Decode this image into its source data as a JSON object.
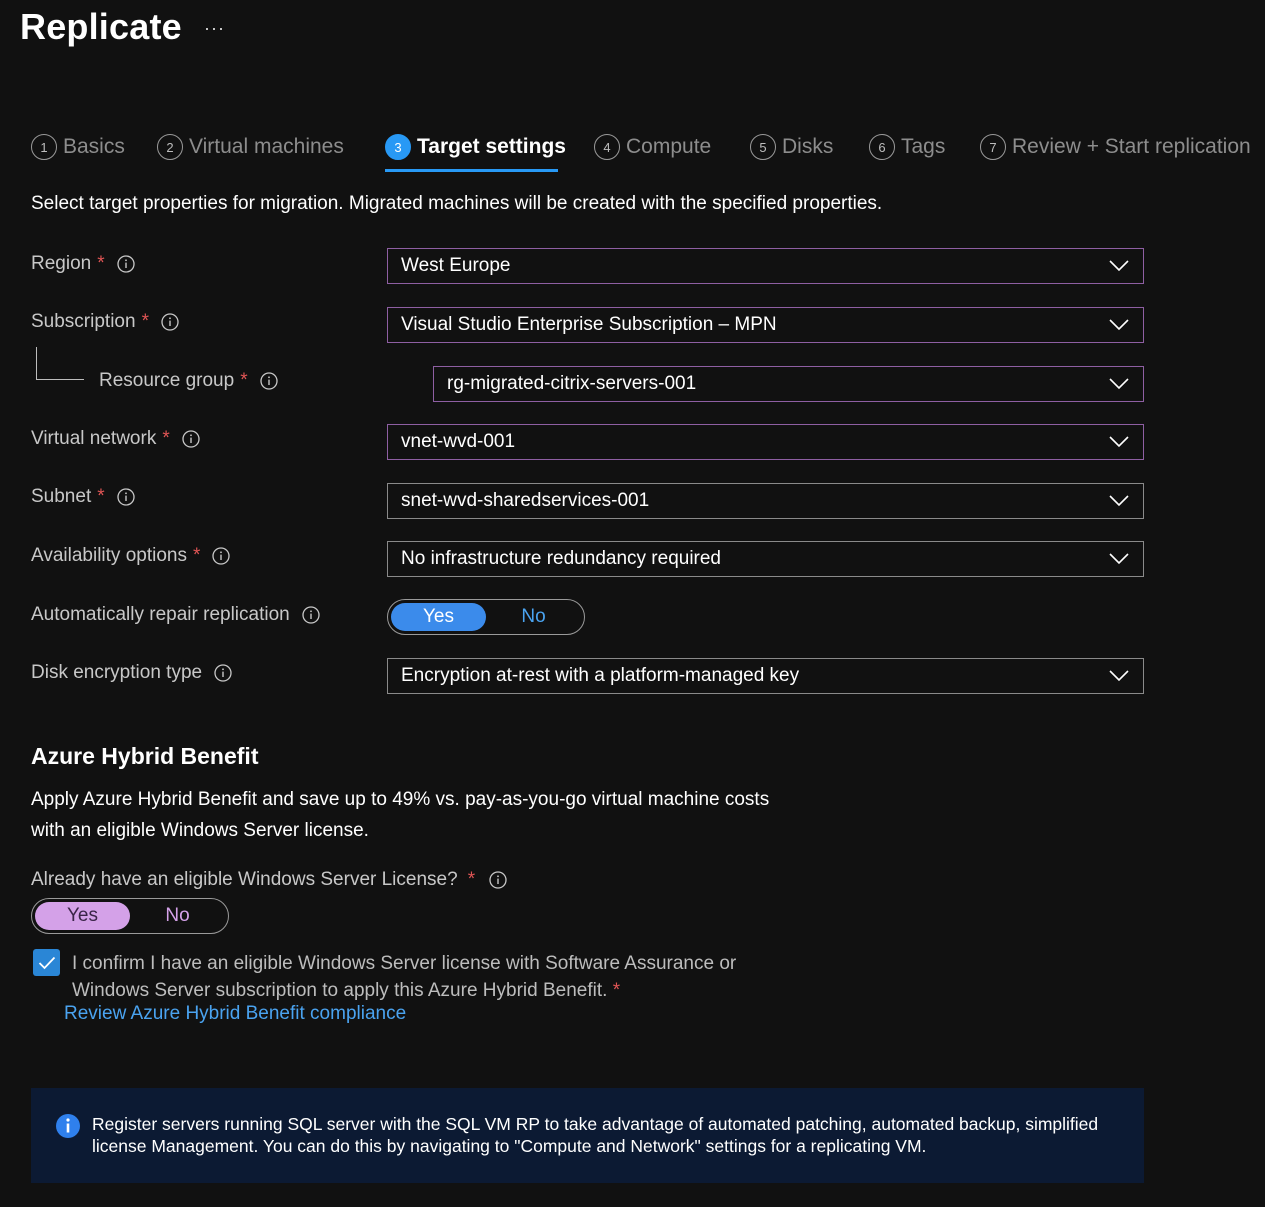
{
  "header": {
    "title": "Replicate",
    "more": "···"
  },
  "tabs": [
    {
      "num": "1",
      "label": "Basics"
    },
    {
      "num": "2",
      "label": "Virtual machines"
    },
    {
      "num": "3",
      "label": "Target settings"
    },
    {
      "num": "4",
      "label": "Compute"
    },
    {
      "num": "5",
      "label": "Disks"
    },
    {
      "num": "6",
      "label": "Tags"
    },
    {
      "num": "7",
      "label": "Review + Start replication"
    }
  ],
  "active_tab": "Target settings",
  "intro": "Select target properties for migration. Migrated machines will be created with the specified properties.",
  "form": {
    "required_mark": "*",
    "region": {
      "label": "Region",
      "value": "West Europe"
    },
    "subscription": {
      "label": "Subscription",
      "value": "Visual Studio Enterprise Subscription – MPN"
    },
    "resource_group": {
      "label": "Resource group",
      "value": "rg-migrated-citrix-servers-001"
    },
    "virtual_network": {
      "label": "Virtual network",
      "value": "vnet-wvd-001"
    },
    "subnet": {
      "label": "Subnet",
      "value": "snet-wvd-sharedservices-001"
    },
    "availability": {
      "label": "Availability options",
      "value": "No infrastructure redundancy required"
    },
    "auto_repair": {
      "label": "Automatically repair replication",
      "yes": "Yes",
      "no": "No",
      "selected": "Yes"
    },
    "disk_encryption": {
      "label": "Disk encryption type",
      "value": "Encryption at-rest with a platform-managed key"
    }
  },
  "hybrid": {
    "heading": "Azure Hybrid Benefit",
    "description_line1": "Apply Azure Hybrid Benefit and save up to 49% vs. pay-as-you-go virtual machine costs",
    "description_line2": "with an eligible Windows Server license.",
    "license_question": "Already have an eligible Windows Server License?",
    "toggle": {
      "yes": "Yes",
      "no": "No",
      "selected": "Yes"
    },
    "confirm_line1": "I confirm I have an eligible Windows Server license with Software Assurance  or",
    "confirm_line2": "Windows Server subscription to apply this Azure Hybrid Benefit.",
    "confirm_checked": true,
    "compliance_link": "Review Azure Hybrid Benefit compliance"
  },
  "banner": {
    "line1": "Register servers running SQL server with the SQL VM RP to take advantage of automated patching, automated backup, simplified",
    "line2": "license Management. You can do this by navigating to \"Compute and Network\" settings for a replicating VM."
  },
  "colors": {
    "accent": "#2899f5",
    "toggle_on_blue": "#3b8beb",
    "toggle_on_purple": "#d4a1e8",
    "required": "#e05555",
    "link": "#4aa3f0",
    "banner_bg": "#0c1a33"
  }
}
